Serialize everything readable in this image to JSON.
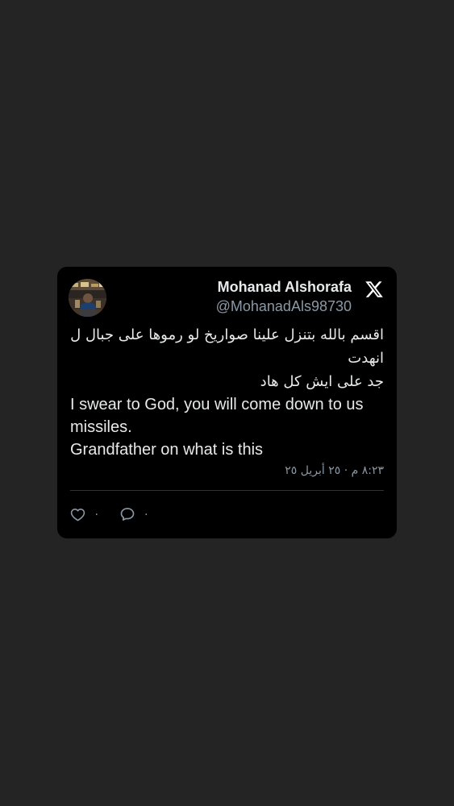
{
  "tweet": {
    "author": {
      "name": "Mohanad Alshorafa",
      "handle": "@MohanadAls98730"
    },
    "text_arabic_line1": "اقسم بالله بتنزل علينا صواريخ لو رموها على جبال ل انهدت",
    "text_arabic_line2": "جد على ايش كل هاد",
    "text_english_line1": "I swear to God, you will come down to us missiles.",
    "text_english_line2": "Grandfather on what is this",
    "timestamp": "٨:٢٣ م · ٢٥ أبريل ٢٥",
    "likes": "٠",
    "replies": "٠"
  },
  "icons": {
    "platform": "x-logo-icon",
    "like": "heart-icon",
    "reply": "reply-bubble-icon"
  },
  "colors": {
    "background": "#242424",
    "card": "#000000",
    "text": "#e7e9ea",
    "muted": "#8b98a5",
    "divider": "#2f3336"
  }
}
